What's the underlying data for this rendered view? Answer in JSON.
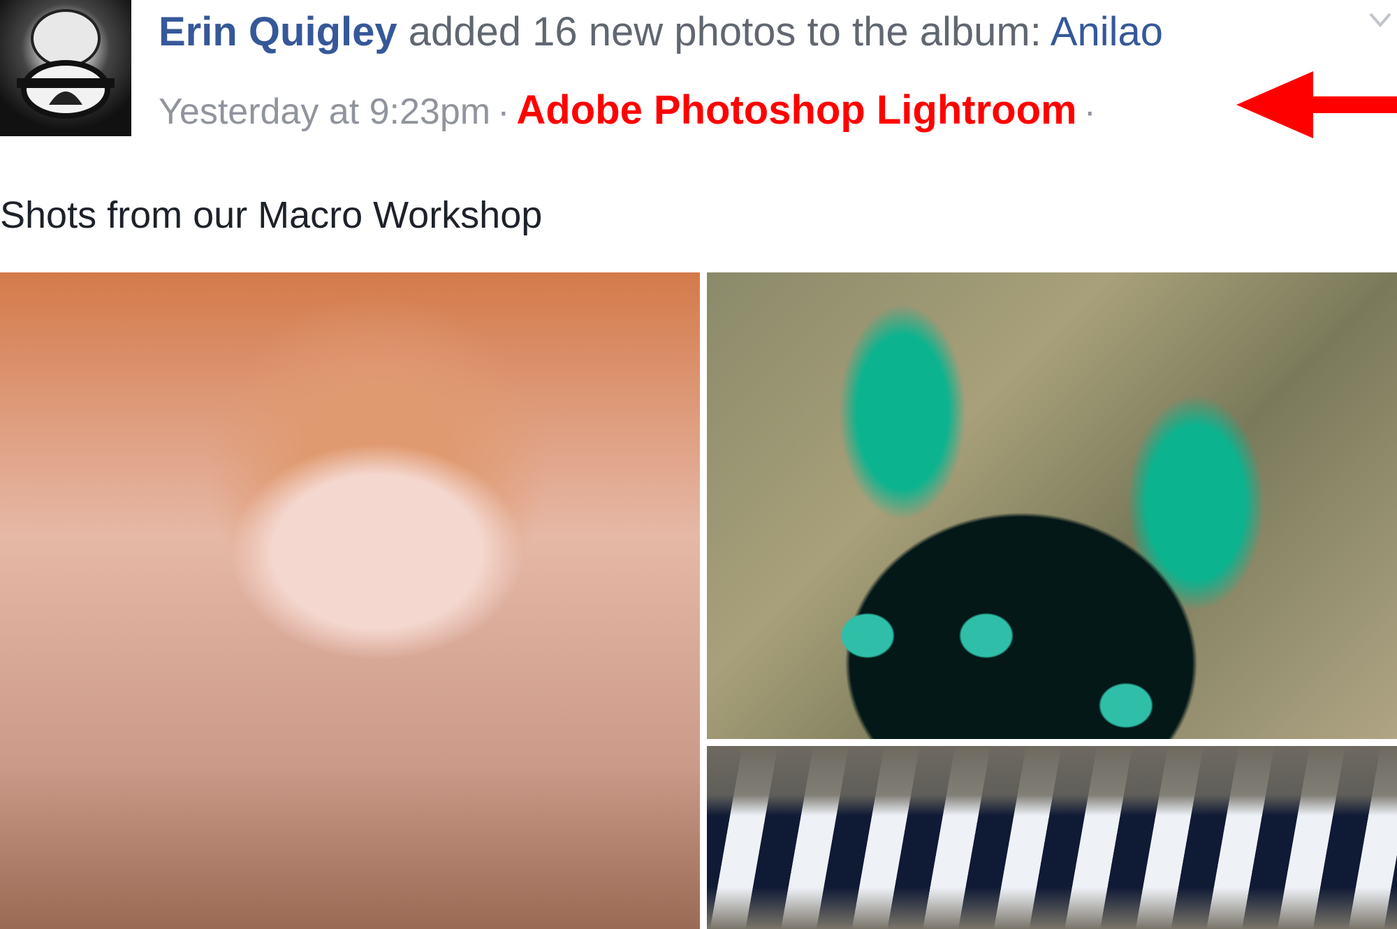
{
  "post": {
    "author": "Erin Quigley",
    "action_text": " added 16 new photos to the album: ",
    "album": "Anilao",
    "timestamp": "Yesterday at 9:23pm",
    "app_name": "Adobe Photoshop Lightroom",
    "separator": "·",
    "caption": "Shots from our Macro Workshop"
  },
  "colors": {
    "link_blue": "#365899",
    "meta_gray": "#90949c",
    "highlight_red": "#ff0000"
  },
  "icons": {
    "avatar": "avatar-diver-mask",
    "menu": "chevron-down-icon",
    "annotation": "red-arrow-left"
  }
}
